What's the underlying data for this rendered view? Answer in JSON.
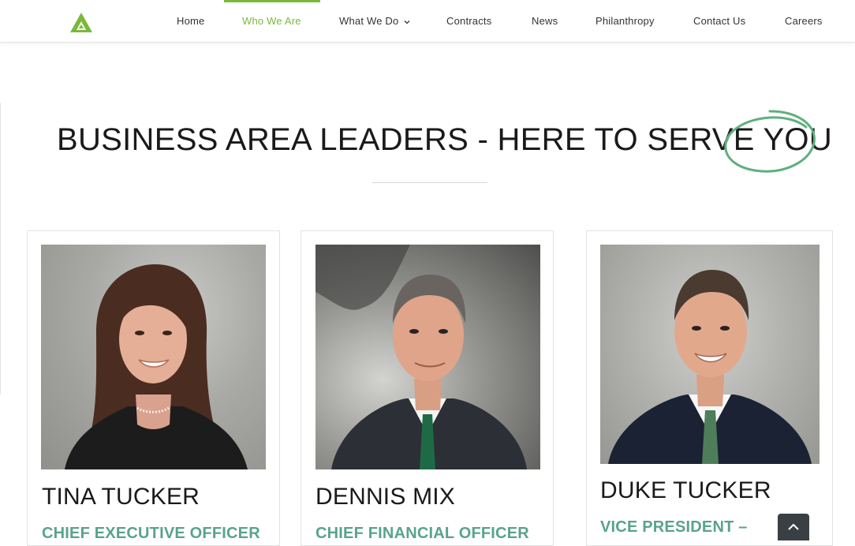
{
  "brand": {
    "accent": "#79b93a",
    "heading_color": "#1a1a1a",
    "role_color": "#5aa38a",
    "logo_icon": "logo-triangle-icon"
  },
  "nav": {
    "items": [
      {
        "label": "Home"
      },
      {
        "label": "Who We Are",
        "active": true
      },
      {
        "label": "What We Do",
        "has_dropdown": true
      },
      {
        "label": "Contracts"
      },
      {
        "label": "News"
      },
      {
        "label": "Philanthropy"
      },
      {
        "label": "Contact Us"
      },
      {
        "label": "Careers"
      }
    ]
  },
  "section": {
    "heading_main": "BUSINESS AREA LEADERS - HERE TO SERVE ",
    "heading_highlight": "YOU"
  },
  "leaders": [
    {
      "name": "TINA TUCKER",
      "role": "CHIEF EXECUTIVE OFFICER"
    },
    {
      "name": "DENNIS MIX",
      "role": "CHIEF FINANCIAL OFFICER"
    },
    {
      "name": "DUKE TUCKER",
      "role": "VICE PRESIDENT –"
    }
  ],
  "scroll_to_top": {
    "icon": "chevron-up-icon"
  }
}
